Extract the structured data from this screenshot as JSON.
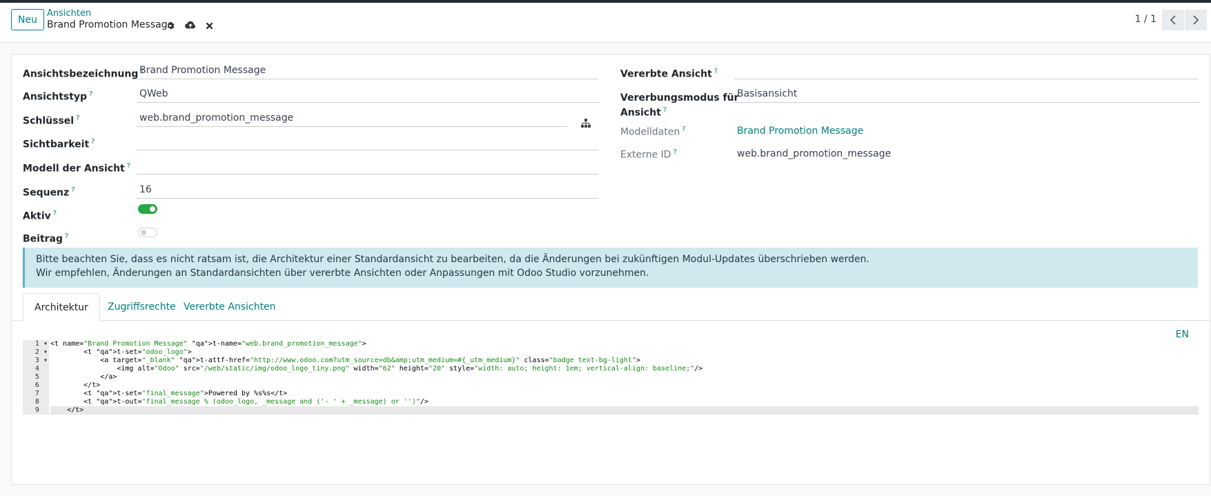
{
  "control_panel": {
    "new_button": "Neu",
    "breadcrumb": "Ansichten",
    "record_title": "Brand Promotion Message",
    "pager": "1 / 1"
  },
  "form": {
    "left": {
      "name_label": "Ansichtsbezeichnung",
      "name_value": "Brand Promotion Message",
      "type_label": "Ansichtstyp",
      "type_value": "QWeb",
      "key_label": "Schlüssel",
      "key_value": "web.brand_promotion_message",
      "visibility_label": "Sichtbarkeit",
      "visibility_value": "",
      "model_label": "Modell der Ansicht",
      "model_value": "",
      "sequence_label": "Sequenz",
      "sequence_value": "16",
      "active_label": "Aktiv",
      "active_value": true,
      "contribution_label": "Beitrag",
      "contribution_value": false
    },
    "right": {
      "inherited_label": "Vererbte Ansicht",
      "inherited_value": "",
      "mode_label_1": "Vererbungsmodus für",
      "mode_label_2": "Ansicht",
      "mode_value": "Basisansicht",
      "model_data_label": "Modelldaten",
      "model_data_value": "Brand Promotion Message",
      "external_id_label": "Externe ID",
      "external_id_value": "web.brand_promotion_message"
    },
    "help_mark": "?"
  },
  "alert": {
    "line1": "Bitte beachten Sie, dass es nicht ratsam ist, die Architektur einer Standardansicht zu bearbeiten, da die Änderungen bei zukünftigen Modul-Updates überschrieben werden.",
    "line2": "Wir empfehlen, Änderungen an Standardansichten über vererbte Ansichten oder Anpassungen mit Odoo Studio vorzunehmen."
  },
  "tabs": [
    {
      "label": "Architektur",
      "active": true
    },
    {
      "label": "Zugriffsrechte",
      "active": false
    },
    {
      "label": "Vererbte Ansichten",
      "active": false
    }
  ],
  "editor": {
    "lang": "EN",
    "line_numbers": [
      "1",
      "2",
      "3",
      "4",
      "5",
      "6",
      "7",
      "8",
      "9"
    ],
    "fold_markers": [
      "▾",
      "▾",
      "▾",
      "",
      "",
      "",
      "",
      "",
      ""
    ],
    "lines": [
      "<t name=\"Brand Promotion Message\" t-name=\"web.brand_promotion_message\">",
      "        <t t-set=\"odoo_logo\">",
      "            <a target=\"_blank\" t-attf-href=\"http://www.odoo.com?utm_source=db&amp;utm_medium=#{_utm_medium}\" class=\"badge text-bg-light\">",
      "                <img alt=\"Odoo\" src=\"/web/static/img/odoo_logo_tiny.png\" width=\"62\" height=\"20\" style=\"width: auto; height: 1em; vertical-align: baseline;\"/>",
      "            </a>",
      "        </t>",
      "        <t t-set=\"final_message\">Powered by %s%s</t>",
      "        <t t-out=\"final_message % (odoo_logo, _message and ('- ' + _message) or '')\"/>",
      "    </t>"
    ]
  },
  "colors": {
    "accent": "#017e84",
    "toggle_on": "#28a745",
    "alert_bg": "#cfe9ee"
  }
}
